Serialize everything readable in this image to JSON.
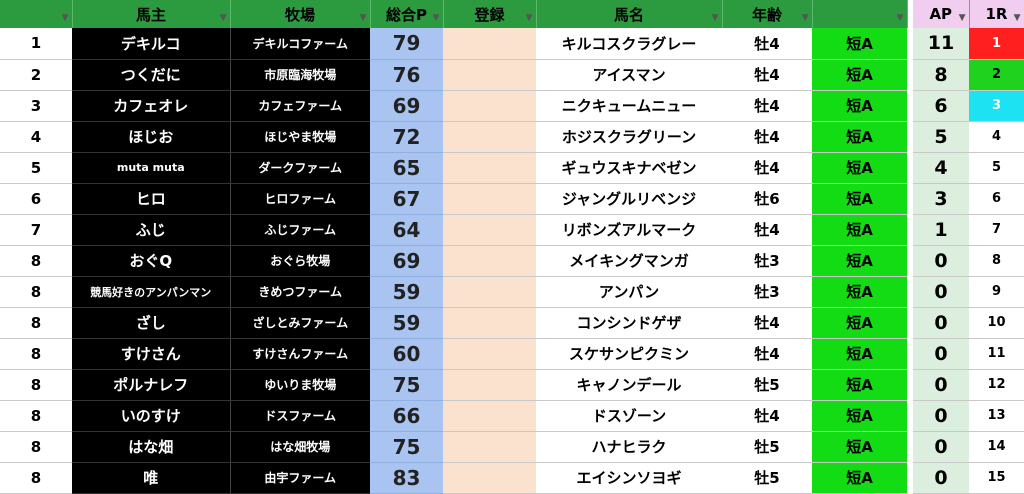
{
  "headers": {
    "rank": "",
    "owner": "馬主",
    "farm": "牧場",
    "total": "総合P",
    "register": "登録",
    "horse": "馬名",
    "age": "年齢",
    "dist": "",
    "ap": "AP",
    "race": "1R"
  },
  "filter_icon": "▼",
  "colors": {
    "header_green": "#2c9a3e",
    "header_pink": "#f1cdf0",
    "total_blue": "#a9c4f0",
    "register_peach": "#fbe2cf",
    "dist_green": "#14dc14",
    "ap_green": "#dceedd",
    "race_red": "#ff1f1f",
    "race_green": "#1ed21e",
    "race_cyan": "#1de2f2"
  },
  "rows": [
    {
      "rank": "1",
      "owner": "デキルコ",
      "farm": "デキルコファーム",
      "total": "79",
      "register": "",
      "horse": "キルコスクラグレー",
      "age": "牡4",
      "dist": "短A",
      "ap": "11",
      "race": "1"
    },
    {
      "rank": "2",
      "owner": "つくだに",
      "farm": "市原臨海牧場",
      "total": "76",
      "register": "",
      "horse": "アイスマン",
      "age": "牡4",
      "dist": "短A",
      "ap": "8",
      "race": "2"
    },
    {
      "rank": "3",
      "owner": "カフェオレ",
      "farm": "カフェファーム",
      "total": "69",
      "register": "",
      "horse": "ニクキュームニュー",
      "age": "牡4",
      "dist": "短A",
      "ap": "6",
      "race": "3"
    },
    {
      "rank": "4",
      "owner": "ほじお",
      "farm": "ほじやま牧場",
      "total": "72",
      "register": "",
      "horse": "ホジスクラグリーン",
      "age": "牡4",
      "dist": "短A",
      "ap": "5",
      "race": "4"
    },
    {
      "rank": "5",
      "owner": "muta muta",
      "farm": "ダークファーム",
      "total": "65",
      "register": "",
      "horse": "ギュウスキナベゼン",
      "age": "牡4",
      "dist": "短A",
      "ap": "4",
      "race": "5"
    },
    {
      "rank": "6",
      "owner": "ヒロ",
      "farm": "ヒロファーム",
      "total": "67",
      "register": "",
      "horse": "ジャングルリベンジ",
      "age": "牡6",
      "dist": "短A",
      "ap": "3",
      "race": "6"
    },
    {
      "rank": "7",
      "owner": "ふじ",
      "farm": "ふじファーム",
      "total": "64",
      "register": "",
      "horse": "リボンズアルマーク",
      "age": "牡4",
      "dist": "短A",
      "ap": "1",
      "race": "7"
    },
    {
      "rank": "8",
      "owner": "おぐQ",
      "farm": "おぐら牧場",
      "total": "69",
      "register": "",
      "horse": "メイキングマンガ",
      "age": "牡3",
      "dist": "短A",
      "ap": "0",
      "race": "8"
    },
    {
      "rank": "8",
      "owner": "競馬好きのアンパンマン",
      "farm": "きめつファーム",
      "total": "59",
      "register": "",
      "horse": "アンパン",
      "age": "牡3",
      "dist": "短A",
      "ap": "0",
      "race": "9"
    },
    {
      "rank": "8",
      "owner": "ざし",
      "farm": "ざしとみファーム",
      "total": "59",
      "register": "",
      "horse": "コンシンドゲザ",
      "age": "牡4",
      "dist": "短A",
      "ap": "0",
      "race": "10"
    },
    {
      "rank": "8",
      "owner": "すけさん",
      "farm": "すけさんファーム",
      "total": "60",
      "register": "",
      "horse": "スケサンピクミン",
      "age": "牡4",
      "dist": "短A",
      "ap": "0",
      "race": "11"
    },
    {
      "rank": "8",
      "owner": "ポルナレフ",
      "farm": "ゆいりま牧場",
      "total": "75",
      "register": "",
      "horse": "キャノンデール",
      "age": "牡5",
      "dist": "短A",
      "ap": "0",
      "race": "12"
    },
    {
      "rank": "8",
      "owner": "いのすけ",
      "farm": "ドスファーム",
      "total": "66",
      "register": "",
      "horse": "ドスゾーン",
      "age": "牡4",
      "dist": "短A",
      "ap": "0",
      "race": "13"
    },
    {
      "rank": "8",
      "owner": "はな畑",
      "farm": "はな畑牧場",
      "total": "75",
      "register": "",
      "horse": "ハナヒラク",
      "age": "牡5",
      "dist": "短A",
      "ap": "0",
      "race": "14"
    },
    {
      "rank": "8",
      "owner": "唯",
      "farm": "由宇ファーム",
      "total": "83",
      "register": "",
      "horse": "エイシンソヨギ",
      "age": "牡5",
      "dist": "短A",
      "ap": "0",
      "race": "15"
    }
  ]
}
